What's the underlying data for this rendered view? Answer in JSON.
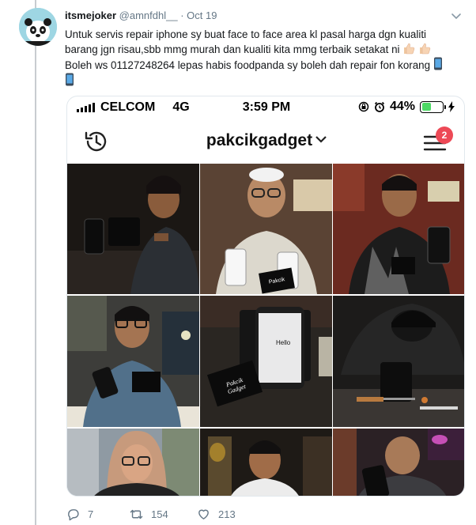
{
  "tweet": {
    "display_name": "itsmejoker",
    "handle": "@amnfdhl__",
    "separator": "·",
    "date": "Oct 19",
    "text_line1": "Untuk servis repair iphone sy buat face to face area kl pasal harga dgn kualiti",
    "text_line2": "barang jgn risau,sbb mmg murah dan kualiti kita mmg terbaik setakat ni",
    "text_line3": "Boleh ws 01127248264 lepas habis foodpanda sy boleh dah repair fon korang",
    "emoji_line2": [
      "thumbs-up-icon",
      "thumbs-up-icon"
    ],
    "emoji_line3": [
      "mobile-phone-icon"
    ],
    "emoji_line4": [
      "mobile-phone-icon"
    ]
  },
  "phone": {
    "carrier": "CELCOM",
    "network": "4G",
    "time": "3:59 PM",
    "battery_percent": "44%",
    "battery_level": 0.44,
    "status_icons": [
      "rotation-lock-icon",
      "alarm-icon",
      "charging-bolt-icon"
    ]
  },
  "instagram": {
    "username": "pakcikgadget",
    "notification_count": "2",
    "photo_label_box": "Pakcik Gadget",
    "photo_screen_text": "Hello"
  },
  "actions": {
    "replies": "7",
    "retweets": "154",
    "likes": "213"
  },
  "colors": {
    "accent_blue": "#1da1f2",
    "muted": "#657786",
    "badge_red": "#ed4956",
    "battery_green": "#4cd964"
  }
}
